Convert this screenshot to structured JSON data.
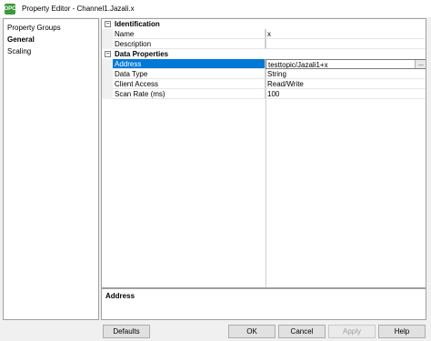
{
  "window": {
    "title": "Property Editor - Channel1.Jazali.x",
    "icon_text": "OPC"
  },
  "left_panel": {
    "header": "Property Groups",
    "items": [
      {
        "label": "General",
        "selected": true
      },
      {
        "label": "Scaling",
        "selected": false
      }
    ]
  },
  "grid": {
    "categories": [
      {
        "label": "Identification",
        "toggle": "−",
        "rows": [
          {
            "name": "Name",
            "value": "x"
          },
          {
            "name": "Description",
            "value": ""
          }
        ]
      },
      {
        "label": "Data Properties",
        "toggle": "−",
        "rows": [
          {
            "name": "Address",
            "value": "testtopic/Jazali1+x",
            "selected": true,
            "button": "..."
          },
          {
            "name": "Data Type",
            "value": "String"
          },
          {
            "name": "Client Access",
            "value": "Read/Write"
          },
          {
            "name": "Scan Rate (ms)",
            "value": "100"
          }
        ]
      }
    ]
  },
  "description": {
    "title": "Address"
  },
  "buttons": {
    "defaults": "Defaults",
    "ok": "OK",
    "cancel": "Cancel",
    "apply": "Apply",
    "help": "Help"
  }
}
